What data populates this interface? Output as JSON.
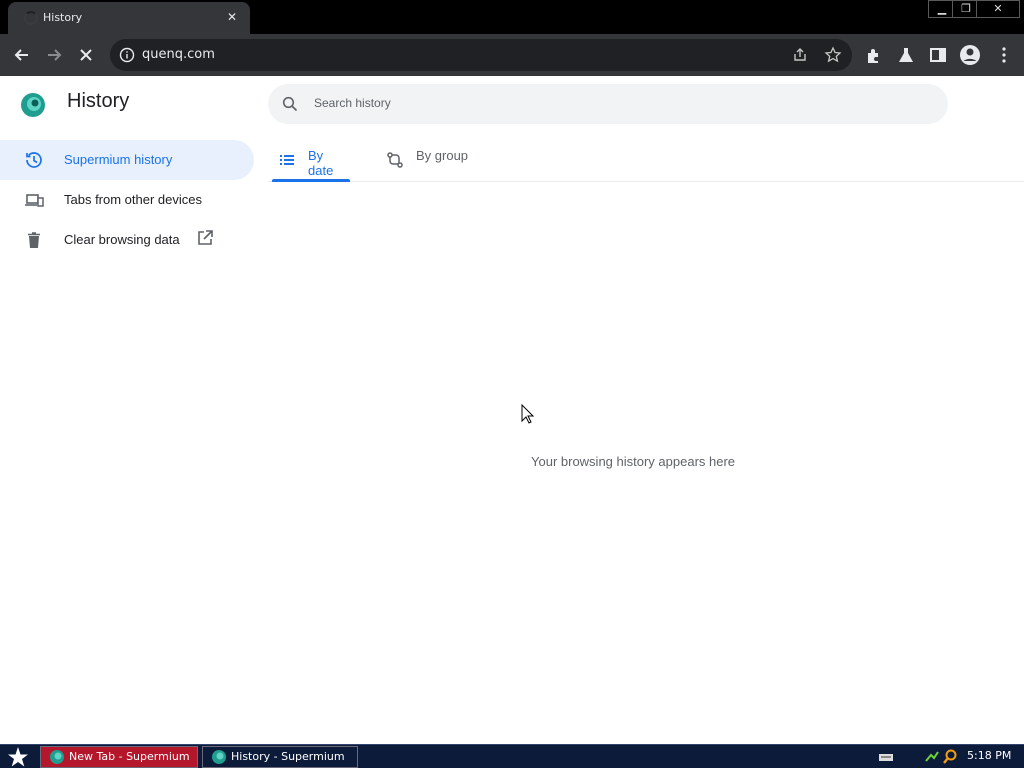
{
  "browser": {
    "tab_title": "History",
    "url": "quenq.com"
  },
  "page": {
    "title": "History",
    "search_placeholder": "Search history",
    "nav": [
      {
        "label": "Supermium history",
        "icon": "history-icon",
        "active": true
      },
      {
        "label": "Tabs from other devices",
        "icon": "devices-icon",
        "active": false
      },
      {
        "label": "Clear browsing data",
        "icon": "trash-icon",
        "active": false
      }
    ],
    "tabs": [
      {
        "label": "By date",
        "icon": "list-icon",
        "active": true
      },
      {
        "label": "By group",
        "icon": "group-icon",
        "active": false
      }
    ],
    "empty_message": "Your browsing history appears here"
  },
  "taskbar": {
    "items": [
      {
        "label": "New Tab - Supermium",
        "active": true
      },
      {
        "label": "History - Supermium",
        "active": false
      }
    ],
    "clock": "5:18 PM"
  },
  "colors": {
    "accent": "#1a73e8",
    "toolbar": "#35363a",
    "taskbar": "#0c1b3a",
    "task_active": "#b4172b"
  }
}
